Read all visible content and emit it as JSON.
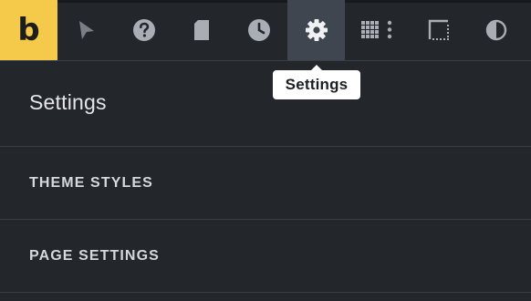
{
  "logo": {
    "text": "b",
    "color": "#f5c94a"
  },
  "toolbar": {
    "buttons": [
      {
        "icon": "cursor-icon"
      },
      {
        "icon": "help-icon"
      },
      {
        "icon": "page-icon"
      },
      {
        "icon": "history-icon"
      },
      {
        "icon": "gear-icon",
        "active": true
      },
      {
        "icon": "grid-menu-icon"
      },
      {
        "icon": "border-icon"
      },
      {
        "icon": "contrast-icon"
      }
    ]
  },
  "tooltip": {
    "text": "Settings"
  },
  "panel": {
    "title": "Settings",
    "items": [
      {
        "label": "THEME STYLES"
      },
      {
        "label": "PAGE SETTINGS"
      }
    ]
  },
  "colors": {
    "background": "#23262b",
    "active_button": "#40464f",
    "icon": "#a9adb4",
    "accent": "#f5c94a"
  }
}
